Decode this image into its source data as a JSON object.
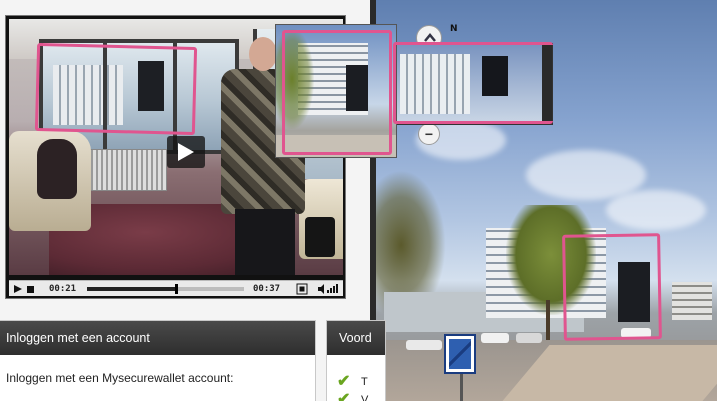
{
  "player": {
    "time_current": "00:21",
    "time_total": "00:37",
    "progress_fraction": 0.568
  },
  "streetview": {
    "compass_label": "N",
    "zoom_out_label": "−"
  },
  "login": {
    "header": "Inloggen met een account",
    "body": "Inloggen met een Mysecurewallet account:"
  },
  "voor": {
    "header": "Voord",
    "item_1": "T",
    "item_2": "V"
  },
  "colors": {
    "highlight": "#e0558f",
    "check_green": "#6aa520",
    "panel_header": "#3a3a3a"
  }
}
